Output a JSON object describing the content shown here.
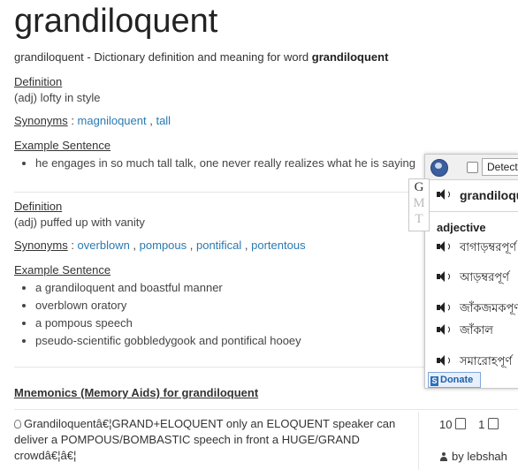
{
  "word": "grandiloquent",
  "intro": {
    "prefix": "grandiloquent - Dictionary definition and meaning for word ",
    "word": "grandiloquent"
  },
  "senses": [
    {
      "definition_label": "Definition",
      "definition": "(adj) lofty in style",
      "synonyms_label": "Synonyms",
      "synonyms": [
        "magniloquent",
        "tall"
      ],
      "example_label": "Example Sentence",
      "examples": [
        "he engages in so much tall talk, one never really realizes what he is saying"
      ]
    },
    {
      "definition_label": "Definition",
      "definition": "(adj) puffed up with vanity",
      "synonyms_label": "Synonyms",
      "synonyms": [
        "overblown",
        "pompous",
        "pontifical",
        "portentous"
      ],
      "example_label": "Example Sentence",
      "examples": [
        "a grandiloquent and boastful manner",
        "overblown oratory",
        "a pompous speech",
        "pseudo-scientific gobbledygook and pontifical hooey"
      ]
    }
  ],
  "synonym_sep": " : ",
  "comma": " , ",
  "mnemonics": {
    "title": "Mnemonics (Memory Aids) for grandiloquent",
    "text": "Grandiloquentâ€¦GRAND+ELOQUENT only an ELOQUENT speaker can deliver a POMPOUS/BOMBASTIC speech in front a HUGE/GRAND crowdâ€¦â€¦",
    "upvotes": "10",
    "downvotes": "1",
    "by_prefix": "by ",
    "author": "lebshah"
  },
  "popup": {
    "detect_label": "Detect",
    "gmt": [
      "G",
      "M",
      "T"
    ],
    "headword": "grandiloquent",
    "pos": "adjective",
    "translations": [
      "বাগাড়ম্বরপূর্ণ",
      "আড়ম্বরপূর্ণ",
      "জাঁকজমকপূর্ণ",
      "জাঁকাল",
      "সমারোহপূর্ণ"
    ],
    "donate_label": "Donate"
  }
}
